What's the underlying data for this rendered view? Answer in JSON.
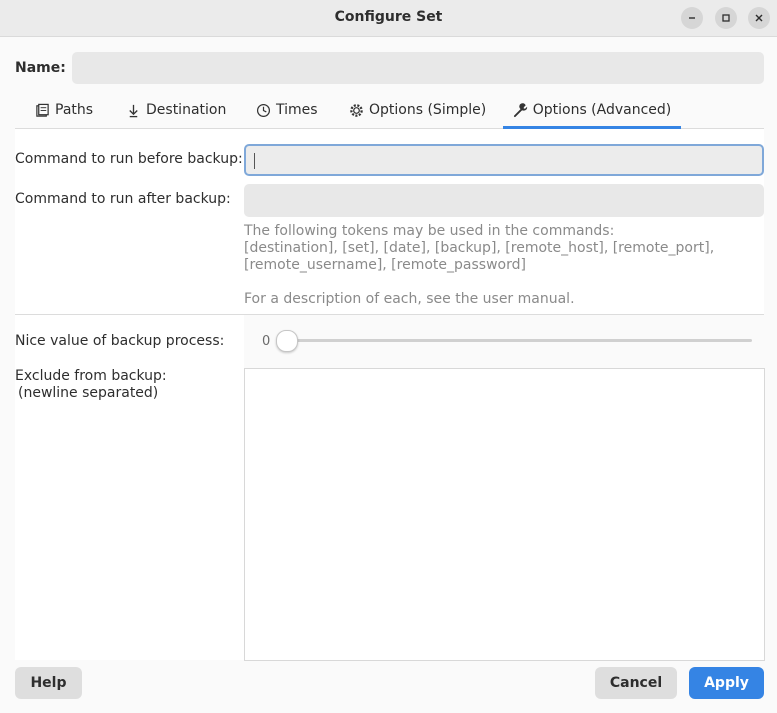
{
  "window": {
    "title": "Configure Set"
  },
  "name": {
    "label": "Name:",
    "value": ""
  },
  "tabs": [
    {
      "label": "Paths",
      "icon": "paths-icon"
    },
    {
      "label": "Destination",
      "icon": "download-icon"
    },
    {
      "label": "Times",
      "icon": "clock-icon"
    },
    {
      "label": "Options (Simple)",
      "icon": "gear-icon"
    },
    {
      "label": "Options (Advanced)",
      "icon": "wrench-icon",
      "active": true
    }
  ],
  "advanced": {
    "before_label": "Command to run before backup:",
    "before_value": "",
    "after_label": "Command to run after backup:",
    "after_value": "",
    "hint_line1": "The following tokens may be used in the commands:",
    "hint_line2": "[destination], [set], [date], [backup], [remote_host], [remote_port],",
    "hint_line3": "[remote_username], [remote_password]",
    "hint_line4": "For a description of each, see the user manual.",
    "nice_label": "Nice value of backup process:",
    "nice_value": "0",
    "exclude_label_1": "Exclude from backup:",
    "exclude_label_2": "(newline separated)",
    "exclude_value": ""
  },
  "buttons": {
    "help": "Help",
    "cancel": "Cancel",
    "apply": "Apply"
  },
  "colors": {
    "accent": "#3584e4"
  }
}
